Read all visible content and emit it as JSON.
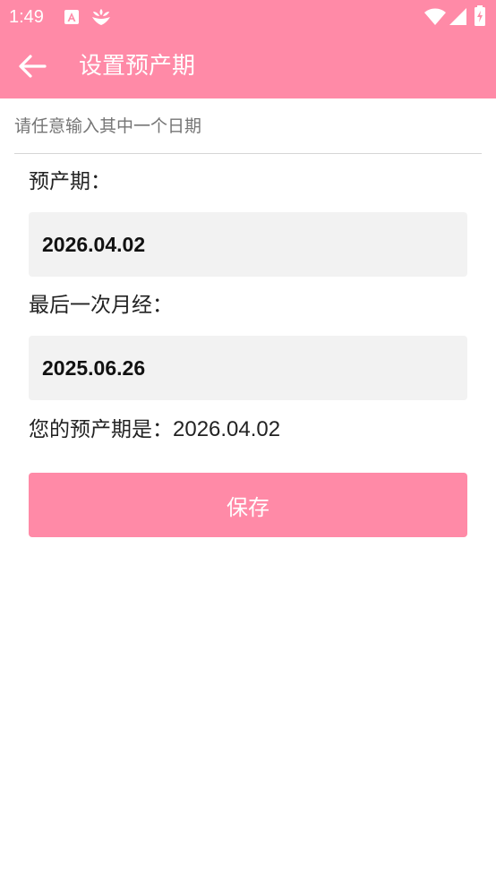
{
  "status_bar": {
    "time": "1:49",
    "icons": [
      "text-a-icon",
      "app-flower-icon",
      "wifi-icon",
      "signal-icon",
      "battery-icon"
    ]
  },
  "app_bar": {
    "title": "设置预产期",
    "back_icon": "arrow-back-icon",
    "background": "#ff8aa7"
  },
  "form": {
    "hint": "请任意输入其中一个日期",
    "due_date_label": "预产期：",
    "due_date_value": "2026.04.02",
    "last_period_label": "最后一次月经：",
    "last_period_value": "2025.06.26",
    "result_label": "您的预产期是：",
    "result_value": "2026.04.02",
    "save_label": "保存"
  },
  "colors": {
    "accent": "#ff8aa7",
    "input_background": "#f2f2f2"
  }
}
